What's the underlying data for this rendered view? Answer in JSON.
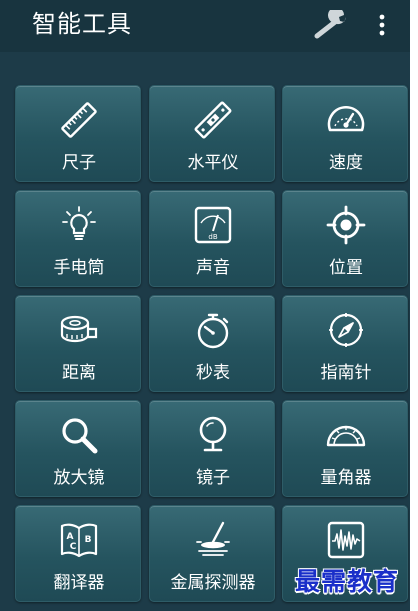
{
  "app_bar": {
    "title": "智能工具",
    "actions": [
      {
        "icon": "wrench-icon"
      },
      {
        "icon": "more-vert-icon"
      }
    ]
  },
  "tools": [
    {
      "label": "尺子",
      "icon": "ruler-icon"
    },
    {
      "label": "水平仪",
      "icon": "spirit-level-icon"
    },
    {
      "label": "速度",
      "icon": "speedometer-icon"
    },
    {
      "label": "手电筒",
      "icon": "lightbulb-icon"
    },
    {
      "label": "声音",
      "icon": "sound-meter-icon",
      "icon_text": "dB"
    },
    {
      "label": "位置",
      "icon": "location-target-icon"
    },
    {
      "label": "距离",
      "icon": "tape-measure-icon"
    },
    {
      "label": "秒表",
      "icon": "stopwatch-icon"
    },
    {
      "label": "指南针",
      "icon": "compass-icon"
    },
    {
      "label": "放大镜",
      "icon": "magnifier-icon"
    },
    {
      "label": "镜子",
      "icon": "mirror-icon"
    },
    {
      "label": "量角器",
      "icon": "protractor-icon"
    },
    {
      "label": "翻译器",
      "icon": "translator-book-icon",
      "icon_text": [
        "A",
        "B",
        "C"
      ]
    },
    {
      "label": "金属探测器",
      "icon": "metal-detector-icon"
    },
    {
      "label": "",
      "icon": "oscilloscope-icon"
    }
  ],
  "watermark": "最需教育",
  "colors": {
    "background": "#1d3b48",
    "app_bar": "#18343f",
    "tile": "#2a5b66",
    "text": "#ffffff",
    "watermark": "#1a2fc9"
  }
}
